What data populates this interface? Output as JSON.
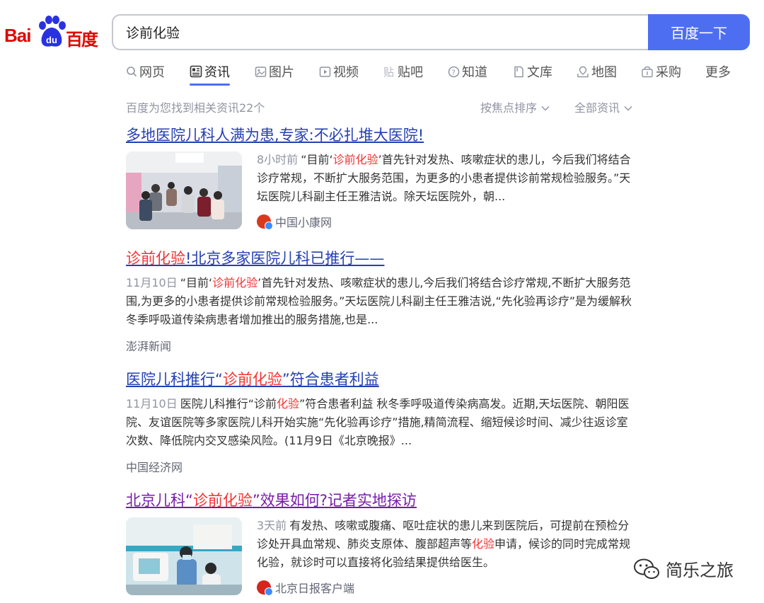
{
  "logo": {
    "bai": "Bai",
    "du_paw": "du",
    "du": "百度"
  },
  "search": {
    "value": "诊前化验",
    "button": "百度一下"
  },
  "tabs": [
    {
      "label": "网页",
      "icon": "search-icon"
    },
    {
      "label": "资讯",
      "icon": "news-icon",
      "active": true
    },
    {
      "label": "图片",
      "icon": "image-icon"
    },
    {
      "label": "视频",
      "icon": "video-icon"
    },
    {
      "label": "贴吧",
      "icon": "tieba-icon"
    },
    {
      "label": "知道",
      "icon": "question-icon"
    },
    {
      "label": "文库",
      "icon": "document-icon"
    },
    {
      "label": "地图",
      "icon": "map-icon"
    },
    {
      "label": "采购",
      "icon": "shop-icon"
    },
    {
      "label": "更多"
    }
  ],
  "meta": {
    "found": "百度为您找到相关资讯22个",
    "sort": "按焦点排序",
    "filter": "全部资讯"
  },
  "results": [
    {
      "title": "多地医院儿科人满为患,专家:不必扎堆大医院!",
      "time": "8小时前",
      "snippet_a": "“目前‘",
      "snippet_hl": "诊前化验",
      "snippet_b": "’首先针对发热、咳嗽症状的患儿，今后我们将结合诊疗常规，不断扩大服务范围，为更多的小患者提供诊前常规检验服务。”天坛医院儿科副主任王雅洁说。除天坛医院外，朝...",
      "source": "中国小康网"
    },
    {
      "title_hl": "诊前化验",
      "title_b": "!北京多家医院儿科已推行——",
      "time": "11月10日",
      "snippet_a": "“目前‘",
      "snippet_hl": "诊前化验",
      "snippet_b": "’首先针对发热、咳嗽症状的患儿,今后我们将结合诊疗常规,不断扩大服务范围,为更多的小患者提供诊前常规检验服务。”天坛医院儿科副主任王雅洁说,“先化验再诊疗”是为缓解秋冬季呼吸道传染病患者增加推出的服务措施,也是...",
      "source": "澎湃新闻"
    },
    {
      "title_a": "医院儿科推行“",
      "title_hl": "诊前化验",
      "title_b": "”符合患者利益",
      "time": "11月10日",
      "snippet_a": "医院儿科推行“诊前",
      "snippet_hl": "化验",
      "snippet_b": "”符合患者利益 秋冬季呼吸道传染病高发。近期,天坛医院、朝阳医院、友谊医院等多家医院儿科开始实施“先化验再诊疗”措施,精简流程、缩短候诊时间、减少往返诊室次数、降低院内交叉感染风险。(11月9日《北京晚报》...",
      "source": "中国经济网"
    },
    {
      "title_a": "北京儿科“",
      "title_hl": "诊前化验",
      "title_b": "”效果如何?记者实地探访",
      "time": "3天前",
      "snippet_a": "有发热、咳嗽或腹痛、呕吐症状的患儿来到医院后，可提前在预检分诊处开具血常规、肺炎支原体、腹部超声等",
      "snippet_hl": "化验",
      "snippet_b": "申请，候诊的同时完成常规化验，就诊时可以直接将化验结果提供给医生。",
      "source": "北京日报客户端"
    }
  ],
  "watermark": "简乐之旅",
  "colors": {
    "brand_red": "#e10601",
    "button_blue": "#4e6ef2",
    "link_blue": "#2440b3",
    "visited": "#771caa",
    "highlight": "#f73131"
  }
}
